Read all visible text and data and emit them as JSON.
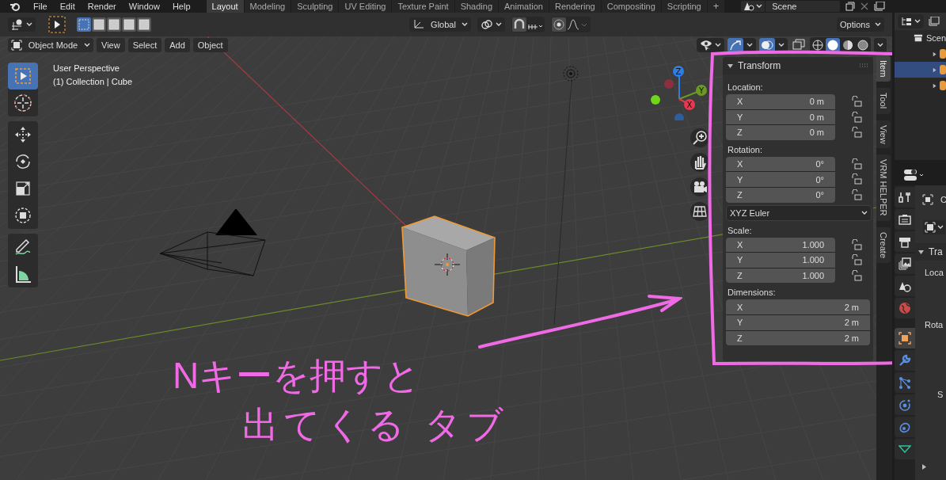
{
  "menu": [
    "File",
    "Edit",
    "Render",
    "Window",
    "Help"
  ],
  "workspaces": [
    {
      "label": "Layout",
      "selected": true
    },
    {
      "label": "Modeling",
      "selected": false
    },
    {
      "label": "Sculpting",
      "selected": false
    },
    {
      "label": "UV Editing",
      "selected": false
    },
    {
      "label": "Texture Paint",
      "selected": false
    },
    {
      "label": "Shading",
      "selected": false
    },
    {
      "label": "Animation",
      "selected": false
    },
    {
      "label": "Rendering",
      "selected": false
    },
    {
      "label": "Compositing",
      "selected": false
    },
    {
      "label": "Scripting",
      "selected": false
    }
  ],
  "add_workspace": "+",
  "scene": "Scene",
  "tool_header": {
    "select_modes": [
      {
        "selected": true
      },
      {
        "selected": false
      },
      {
        "selected": false
      },
      {
        "selected": false
      },
      {
        "selected": false
      }
    ],
    "orientation": "Global",
    "snap_on": false,
    "proportional_on": false,
    "options": "Options"
  },
  "view_header": {
    "mode": "Object Mode",
    "menus": [
      "View",
      "Select",
      "Add",
      "Object"
    ],
    "gizmos_on": true,
    "overlays_on": true,
    "shading": [
      {
        "selected": false
      },
      {
        "selected": true
      },
      {
        "selected": false
      },
      {
        "selected": false
      }
    ]
  },
  "viewport": {
    "perspective": "User Perspective",
    "collection": "(1) Collection | Cube",
    "gizmo": [
      {
        "label": "Z"
      },
      {
        "label": "Y"
      },
      {
        "label": "X"
      }
    ]
  },
  "tool_groups": [
    {
      "tools": [
        {
          "kind": "select",
          "selected": true
        },
        {
          "kind": "cursor",
          "selected": false
        }
      ]
    },
    {
      "tools": [
        {
          "kind": "move",
          "selected": false
        },
        {
          "kind": "rotate",
          "selected": false
        },
        {
          "kind": "scale",
          "selected": false
        },
        {
          "kind": "transform",
          "selected": false
        }
      ]
    },
    {
      "tools": [
        {
          "kind": "annotate",
          "selected": false
        },
        {
          "kind": "measure",
          "selected": false
        }
      ]
    }
  ],
  "sidebar": {
    "panel_title": "Transform",
    "rotation_mode": "XYZ Euler",
    "groups": [
      {
        "label": "Location:",
        "lockable": true,
        "fields": [
          {
            "axis": "X",
            "value": "0 m"
          },
          {
            "axis": "Y",
            "value": "0 m"
          },
          {
            "axis": "Z",
            "value": "0 m"
          }
        ]
      },
      {
        "label": "Rotation:",
        "lockable": true,
        "mode_after": true,
        "fields": [
          {
            "axis": "X",
            "value": "0°"
          },
          {
            "axis": "Y",
            "value": "0°"
          },
          {
            "axis": "Z",
            "value": "0°"
          }
        ]
      },
      {
        "label": "Scale:",
        "lockable": true,
        "fields": [
          {
            "axis": "X",
            "value": "1.000"
          },
          {
            "axis": "Y",
            "value": "1.000"
          },
          {
            "axis": "Z",
            "value": "1.000"
          }
        ]
      },
      {
        "label": "Dimensions:",
        "lockable": false,
        "fields": [
          {
            "axis": "X",
            "value": "2 m"
          },
          {
            "axis": "Y",
            "value": "2 m"
          },
          {
            "axis": "Z",
            "value": "2 m"
          }
        ]
      }
    ],
    "tabs": [
      {
        "label": "Item",
        "selected": true
      },
      {
        "label": "Tool",
        "selected": false
      },
      {
        "label": "View",
        "selected": false
      },
      {
        "label": "VRM HELPER",
        "selected": false
      },
      {
        "label": "Create",
        "selected": false
      }
    ]
  },
  "annotation": {
    "lines": [
      "Nキーを押すと",
      "出てくる タブ"
    ]
  },
  "outliner": {
    "title": "Scen",
    "rows": [
      {
        "selected": false
      },
      {
        "selected": true
      },
      {
        "selected": false
      }
    ]
  },
  "properties": {
    "object_name": "C",
    "panel": "Tra",
    "labels": [
      "Loca",
      "Rota",
      "S"
    ],
    "tabs": [
      {
        "kind": "tool",
        "selected": false
      },
      {
        "kind": "render",
        "selected": false
      },
      {
        "kind": "output",
        "selected": false
      },
      {
        "kind": "view_layer",
        "selected": false
      },
      {
        "kind": "scene",
        "selected": false
      },
      {
        "kind": "world",
        "selected": false
      },
      {
        "kind": "object",
        "selected": true
      },
      {
        "kind": "modifiers",
        "selected": false
      },
      {
        "kind": "particles",
        "selected": false
      },
      {
        "kind": "physics",
        "selected": false
      },
      {
        "kind": "constraints",
        "selected": false
      },
      {
        "kind": "data",
        "selected": false
      }
    ]
  }
}
